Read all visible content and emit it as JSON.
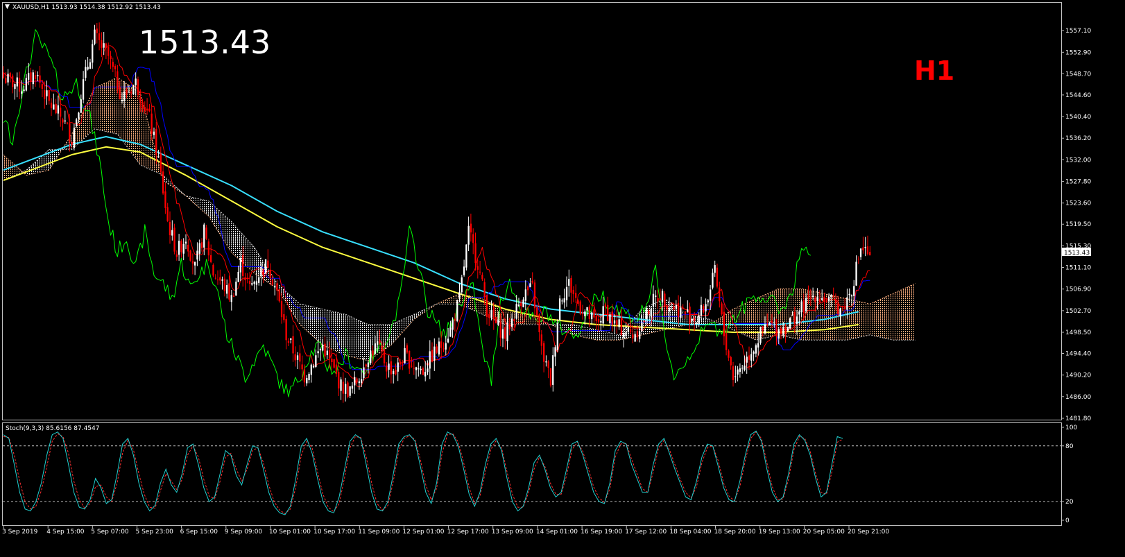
{
  "window": {
    "symbol_header": "XAUUSD,H1  1513.93 1514.38 1512.92 1513.43",
    "big_price": "1513.43",
    "timeframe_badge": "H1",
    "current_price_tag": "1513.43"
  },
  "colors": {
    "background": "#000000",
    "frame": "#c0c0c0",
    "candle_up": "#ffffff",
    "candle_down": "#ff0000",
    "tenkan": "#ff0000",
    "kijun": "#0000ff",
    "chikou": "#00ff00",
    "cloud_bull": "#ffb080",
    "cloud_bear": "#ffffff",
    "ma_fast": "#38e0ff",
    "ma_slow": "#ffff40",
    "stoch_main": "#20d0d0",
    "stoch_signal": "#ff3030",
    "badge": "#ff0000"
  },
  "chart_data": [
    {
      "type": "candlestick",
      "title": "XAUUSD,H1  1513.93 1514.38 1512.92 1513.43",
      "ylim": [
        1481.8,
        1559.0
      ],
      "y_ticks": [
        "1557.10",
        "1552.90",
        "1548.70",
        "1544.60",
        "1540.40",
        "1536.20",
        "1532.00",
        "1527.80",
        "1523.60",
        "1519.50",
        "1515.30",
        "1511.10",
        "1506.90",
        "1502.70",
        "1498.50",
        "1494.40",
        "1490.20",
        "1486.00",
        "1481.80"
      ],
      "x_ticks": [
        "3 Sep 2019",
        "4 Sep 15:00",
        "5 Sep 07:00",
        "5 Sep 23:00",
        "6 Sep 15:00",
        "9 Sep 09:00",
        "10 Sep 01:00",
        "10 Sep 17:00",
        "11 Sep 09:00",
        "12 Sep 01:00",
        "12 Sep 17:00",
        "13 Sep 09:00",
        "14 Sep 01:00",
        "16 Sep 19:00",
        "17 Sep 12:00",
        "18 Sep 04:00",
        "18 Sep 20:00",
        "19 Sep 13:00",
        "20 Sep 05:00",
        "20 Sep 21:00"
      ],
      "close_path": [
        [
          0,
          1548
        ],
        [
          8,
          1546
        ],
        [
          14,
          1549
        ],
        [
          20,
          1543
        ],
        [
          26,
          1540
        ],
        [
          30,
          1536
        ],
        [
          34,
          1545
        ],
        [
          40,
          1556
        ],
        [
          46,
          1552
        ],
        [
          52,
          1544
        ],
        [
          58,
          1547
        ],
        [
          64,
          1540
        ],
        [
          68,
          1532
        ],
        [
          72,
          1520
        ],
        [
          76,
          1514
        ],
        [
          80,
          1517
        ],
        [
          84,
          1511
        ],
        [
          88,
          1518
        ],
        [
          92,
          1510
        ],
        [
          96,
          1508
        ],
        [
          100,
          1505
        ],
        [
          104,
          1512
        ],
        [
          108,
          1507
        ],
        [
          112,
          1510
        ],
        [
          116,
          1512
        ],
        [
          120,
          1506
        ],
        [
          124,
          1498
        ],
        [
          128,
          1494
        ],
        [
          132,
          1490
        ],
        [
          136,
          1493
        ],
        [
          140,
          1496
        ],
        [
          144,
          1492
        ],
        [
          148,
          1488
        ],
        [
          152,
          1487
        ],
        [
          156,
          1490
        ],
        [
          160,
          1494
        ],
        [
          164,
          1496
        ],
        [
          168,
          1492
        ],
        [
          172,
          1491
        ],
        [
          176,
          1494
        ],
        [
          180,
          1492
        ],
        [
          184,
          1491
        ],
        [
          188,
          1494
        ],
        [
          192,
          1496
        ],
        [
          196,
          1499
        ],
        [
          200,
          1505
        ],
        [
          204,
          1518
        ],
        [
          208,
          1512
        ],
        [
          212,
          1503
        ],
        [
          216,
          1500
        ],
        [
          220,
          1498
        ],
        [
          224,
          1502
        ],
        [
          228,
          1506
        ],
        [
          232,
          1507
        ],
        [
          236,
          1495
        ],
        [
          240,
          1489
        ],
        [
          244,
          1505
        ],
        [
          248,
          1508
        ],
        [
          252,
          1504
        ],
        [
          256,
          1502
        ],
        [
          260,
          1500
        ],
        [
          264,
          1503
        ],
        [
          268,
          1500
        ],
        [
          272,
          1499
        ],
        [
          276,
          1498
        ],
        [
          280,
          1500
        ],
        [
          284,
          1504
        ],
        [
          288,
          1506
        ],
        [
          292,
          1504
        ],
        [
          296,
          1503
        ],
        [
          300,
          1502
        ],
        [
          304,
          1501
        ],
        [
          308,
          1504
        ],
        [
          312,
          1510
        ],
        [
          316,
          1498
        ],
        [
          320,
          1490
        ],
        [
          324,
          1492
        ],
        [
          328,
          1495
        ],
        [
          332,
          1498
        ],
        [
          336,
          1500
        ],
        [
          340,
          1499
        ],
        [
          344,
          1500
        ],
        [
          348,
          1502
        ],
        [
          352,
          1504
        ],
        [
          356,
          1506
        ],
        [
          360,
          1505
        ],
        [
          364,
          1504
        ],
        [
          368,
          1503
        ],
        [
          372,
          1507
        ],
        [
          376,
          1515
        ],
        [
          380,
          1513.43
        ]
      ],
      "ma_fast": [
        [
          0,
          1530
        ],
        [
          30,
          1535
        ],
        [
          45,
          1536.5
        ],
        [
          60,
          1535
        ],
        [
          80,
          1531
        ],
        [
          100,
          1527
        ],
        [
          120,
          1522
        ],
        [
          140,
          1518
        ],
        [
          160,
          1515
        ],
        [
          180,
          1512
        ],
        [
          200,
          1508
        ],
        [
          220,
          1505
        ],
        [
          240,
          1503
        ],
        [
          260,
          1502
        ],
        [
          280,
          1501
        ],
        [
          300,
          1500
        ],
        [
          320,
          1500
        ],
        [
          340,
          1500
        ],
        [
          360,
          1501
        ],
        [
          375,
          1502.5
        ]
      ],
      "ma_slow": [
        [
          0,
          1528
        ],
        [
          30,
          1533
        ],
        [
          45,
          1534.5
        ],
        [
          60,
          1533.5
        ],
        [
          80,
          1529
        ],
        [
          100,
          1524
        ],
        [
          120,
          1519
        ],
        [
          140,
          1515
        ],
        [
          160,
          1512
        ],
        [
          180,
          1509
        ],
        [
          200,
          1506
        ],
        [
          220,
          1503
        ],
        [
          240,
          1501
        ],
        [
          260,
          1500
        ],
        [
          280,
          1499.5
        ],
        [
          300,
          1499
        ],
        [
          320,
          1498.5
        ],
        [
          340,
          1498.5
        ],
        [
          360,
          1499
        ],
        [
          375,
          1500
        ]
      ],
      "cloud": [
        [
          0,
          1533,
          1528
        ],
        [
          10,
          1529,
          1530
        ],
        [
          20,
          1530,
          1534
        ],
        [
          30,
          1537,
          1534
        ],
        [
          40,
          1546,
          1538
        ],
        [
          50,
          1548,
          1537
        ],
        [
          60,
          1545,
          1531
        ],
        [
          70,
          1528,
          1529
        ],
        [
          80,
          1525,
          1525
        ],
        [
          90,
          1521,
          1524
        ],
        [
          100,
          1514,
          1520
        ],
        [
          110,
          1510,
          1515
        ],
        [
          120,
          1507,
          1508
        ],
        [
          130,
          1500,
          1504
        ],
        [
          140,
          1496,
          1503
        ],
        [
          150,
          1494,
          1502
        ],
        [
          160,
          1493,
          1500
        ],
        [
          170,
          1496,
          1500
        ],
        [
          180,
          1501,
          1502
        ],
        [
          190,
          1504,
          1504
        ],
        [
          200,
          1506,
          1504
        ],
        [
          210,
          1505,
          1502
        ],
        [
          220,
          1503,
          1500
        ],
        [
          230,
          1502,
          1500
        ],
        [
          240,
          1500,
          1500
        ],
        [
          250,
          1498,
          1500
        ],
        [
          260,
          1497,
          1499
        ],
        [
          270,
          1497,
          1498
        ],
        [
          280,
          1498,
          1503
        ],
        [
          290,
          1499,
          1505
        ],
        [
          300,
          1500,
          1502
        ],
        [
          310,
          1500,
          1501
        ],
        [
          320,
          1503,
          1499
        ],
        [
          330,
          1505,
          1497
        ],
        [
          340,
          1507,
          1498
        ],
        [
          350,
          1507,
          1497
        ],
        [
          360,
          1506,
          1497
        ],
        [
          370,
          1505,
          1497
        ],
        [
          380,
          1504,
          1498
        ],
        [
          390,
          1506,
          1497
        ],
        [
          400,
          1508,
          1497
        ]
      ],
      "bars_total": 400
    },
    {
      "type": "line",
      "title": "Stoch(9,3,3) 85.6156 87.4547",
      "ylim": [
        0,
        100
      ],
      "y_ticks": [
        "100",
        "80",
        "20",
        "0"
      ],
      "levels": [
        80,
        20
      ],
      "main": [
        92,
        88,
        60,
        30,
        12,
        10,
        20,
        40,
        70,
        92,
        95,
        88,
        60,
        30,
        14,
        12,
        22,
        45,
        35,
        18,
        22,
        50,
        82,
        88,
        70,
        40,
        20,
        10,
        16,
        40,
        55,
        38,
        30,
        50,
        78,
        82,
        60,
        35,
        20,
        25,
        50,
        75,
        70,
        48,
        38,
        60,
        80,
        78,
        55,
        30,
        15,
        8,
        6,
        15,
        45,
        80,
        88,
        72,
        45,
        20,
        10,
        8,
        25,
        55,
        85,
        92,
        88,
        60,
        30,
        12,
        10,
        20,
        50,
        82,
        90,
        92,
        85,
        58,
        30,
        18,
        40,
        82,
        95,
        92,
        80,
        55,
        28,
        15,
        30,
        60,
        82,
        88,
        75,
        45,
        20,
        10,
        15,
        35,
        62,
        70,
        55,
        35,
        25,
        30,
        55,
        82,
        85,
        70,
        50,
        30,
        20,
        18,
        40,
        75,
        85,
        82,
        60,
        45,
        30,
        30,
        60,
        82,
        88,
        72,
        55,
        40,
        25,
        22,
        42,
        68,
        82,
        80,
        58,
        35,
        22,
        20,
        42,
        70,
        92,
        96,
        85,
        55,
        30,
        20,
        25,
        50,
        82,
        92,
        86,
        70,
        45,
        25,
        30,
        60,
        90,
        88
      ],
      "signal": [
        90,
        89,
        70,
        42,
        20,
        12,
        15,
        32,
        58,
        85,
        93,
        90,
        72,
        42,
        22,
        13,
        18,
        36,
        38,
        25,
        20,
        40,
        72,
        86,
        76,
        50,
        28,
        14,
        13,
        32,
        50,
        42,
        33,
        44,
        70,
        80,
        68,
        44,
        26,
        23,
        42,
        68,
        72,
        55,
        42,
        55,
        75,
        78,
        62,
        38,
        20,
        11,
        7,
        12,
        36,
        70,
        85,
        78,
        52,
        28,
        14,
        9,
        18,
        46,
        78,
        90,
        89,
        68,
        40,
        18,
        11,
        16,
        42,
        75,
        88,
        91,
        87,
        65,
        38,
        22,
        34,
        72,
        92,
        93,
        84,
        62,
        35,
        18,
        26,
        52,
        76,
        86,
        78,
        52,
        28,
        14,
        14,
        30,
        55,
        68,
        58,
        40,
        28,
        28,
        48,
        76,
        84,
        74,
        56,
        36,
        24,
        19,
        34,
        68,
        82,
        83,
        66,
        50,
        34,
        30,
        52,
        78,
        86,
        76,
        60,
        44,
        30,
        24,
        36,
        62,
        78,
        80,
        64,
        40,
        26,
        21,
        36,
        64,
        88,
        95,
        88,
        62,
        36,
        22,
        23,
        44,
        76,
        90,
        88,
        74,
        50,
        30,
        28,
        52,
        84,
        87
      ]
    }
  ]
}
